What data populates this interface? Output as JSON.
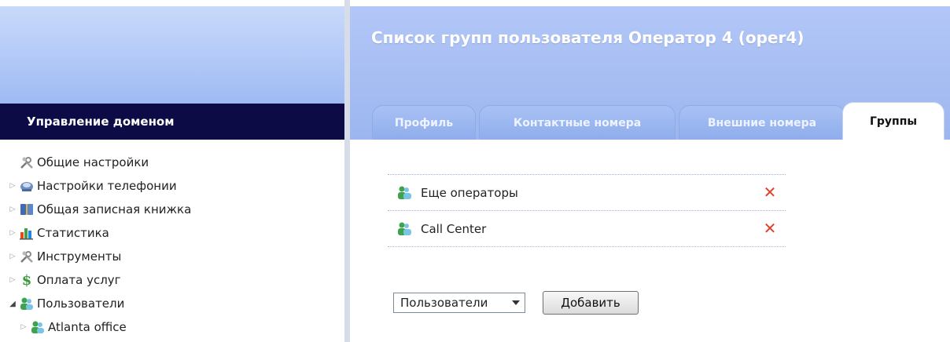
{
  "sidebar": {
    "header": "Управление доменом",
    "items": [
      {
        "label": "Общие настройки",
        "icon": "tools-icon",
        "expandable": false
      },
      {
        "label": "Настройки телефонии",
        "icon": "phone-settings-icon",
        "expandable": true
      },
      {
        "label": "Общая записная книжка",
        "icon": "address-book-icon",
        "expandable": true
      },
      {
        "label": "Статистика",
        "icon": "statistics-icon",
        "expandable": true
      },
      {
        "label": "Инструменты",
        "icon": "tools-icon",
        "expandable": true
      },
      {
        "label": "Оплата услуг",
        "icon": "dollar-icon",
        "expandable": true
      },
      {
        "label": "Пользователи",
        "icon": "users-icon",
        "expandable": true,
        "expanded": true
      },
      {
        "label": "Atlanta office",
        "icon": "users-icon",
        "expandable": true
      }
    ]
  },
  "page": {
    "title": "Список групп пользователя Оператор 4 (oper4)"
  },
  "tabs": [
    {
      "label": "Профиль",
      "active": false
    },
    {
      "label": "Контактные номера",
      "active": false
    },
    {
      "label": "Внешние номера",
      "active": false
    },
    {
      "label": "Группы",
      "active": true
    }
  ],
  "groups": [
    {
      "name": "Еще операторы"
    },
    {
      "name": "Call Center"
    }
  ],
  "controls": {
    "select_value": "Пользователи",
    "add_label": "Добавить"
  },
  "colors": {
    "header_bg": "#0c0b46",
    "banner": "#9cb6ef",
    "remove": "#e0402a"
  }
}
